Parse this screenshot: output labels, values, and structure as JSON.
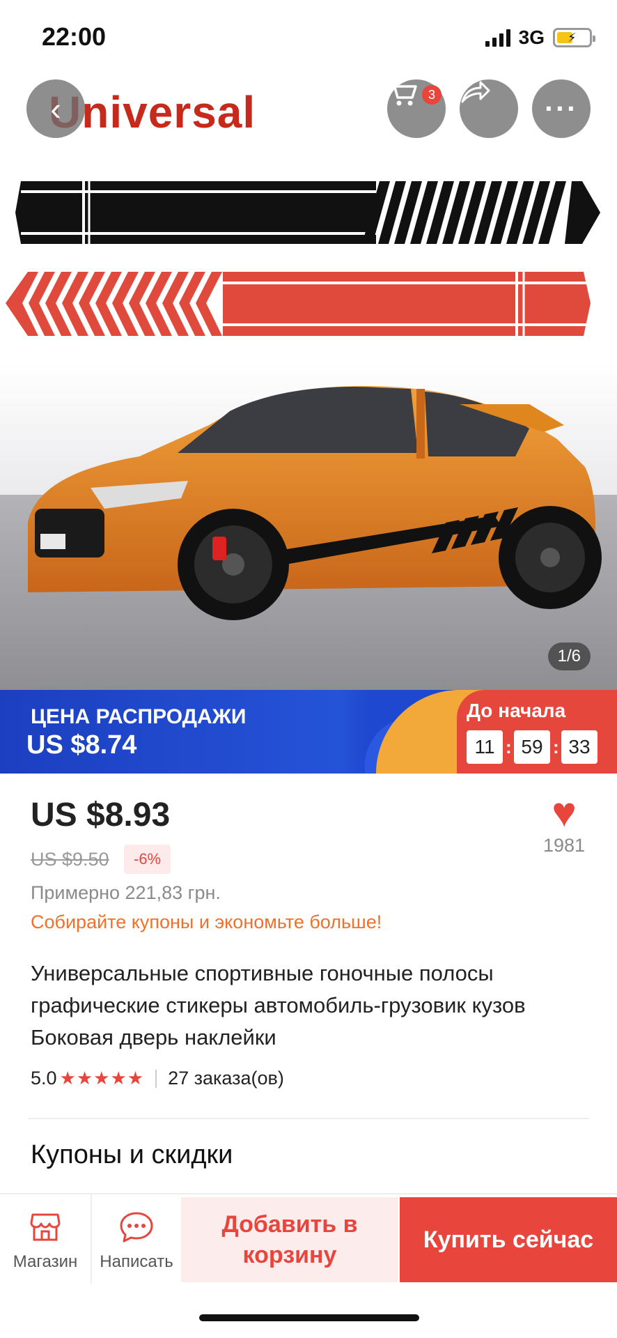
{
  "status_bar": {
    "time": "22:00",
    "network": "3G"
  },
  "header": {
    "brand_text": "Universal",
    "back_icon": "chevron-left-icon",
    "cart_icon": "cart-icon",
    "cart_badge": "3",
    "share_icon": "share-icon",
    "more_icon": "more-icon",
    "more_glyph": "···"
  },
  "gallery": {
    "counter": "1/6"
  },
  "sale": {
    "title": "ЦЕНА РАСПРОДАЖИ",
    "price": "US $8.74",
    "countdown_label": "До начала",
    "hours": "11",
    "minutes": "59",
    "seconds": "33"
  },
  "product": {
    "price": "US $8.93",
    "old_price": "US $9.50",
    "discount": "-6%",
    "approx": "Примерно 221,83 грн.",
    "coupon_link": "Собирайте купоны и экономьте больше!",
    "wish_count": "1981",
    "title": "Универсальные спортивные гоночные полосы графические стикеры автомобиль-грузовик кузов Боковая дверь наклейки",
    "rating": "5.0",
    "stars": "★★★★★",
    "orders": "27 заказа(ов)"
  },
  "section": {
    "title": "Купоны и скидки"
  },
  "bottom_bar": {
    "shop_label": "Магазин",
    "chat_label": "Написать",
    "add_to_cart": "Добавить в корзину",
    "buy_now": "Купить сейчас"
  },
  "colors": {
    "accent": "#e8453c",
    "sale_blue": "#2553d8",
    "coupon_orange": "#f1702a",
    "car_orange": "#e0861f"
  }
}
